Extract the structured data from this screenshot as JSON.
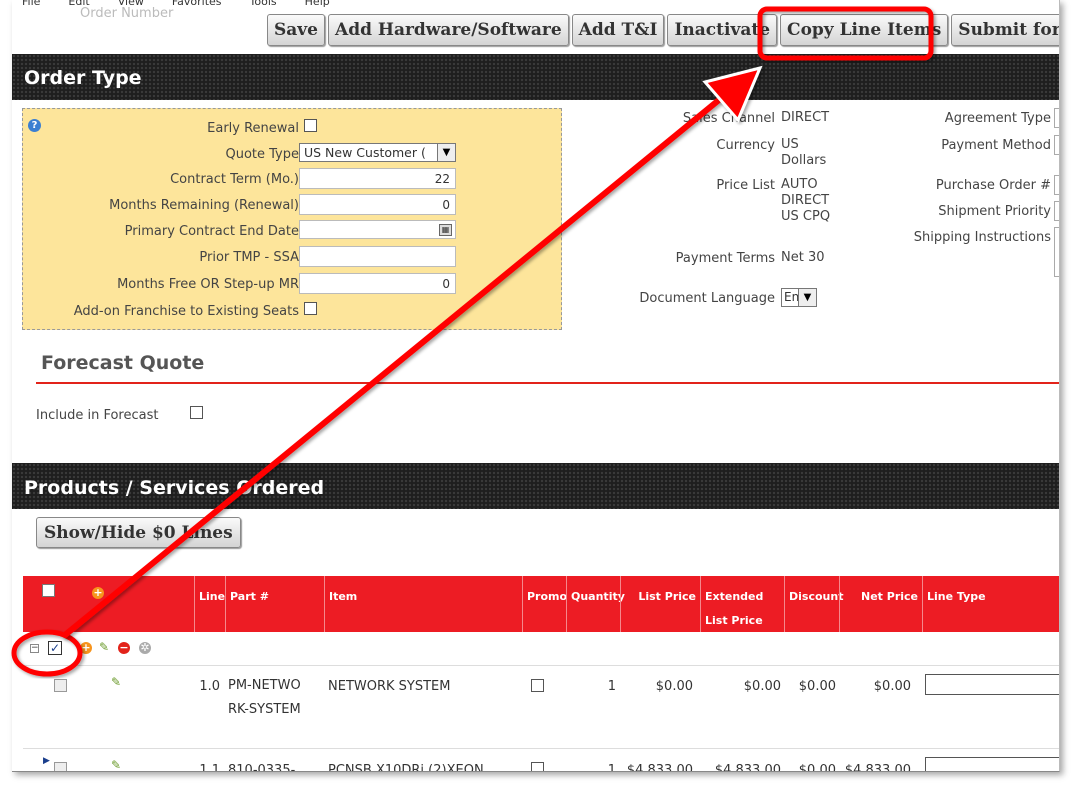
{
  "menubar": [
    "File",
    "Edit",
    "View",
    "Favorites",
    "Tools",
    "Help"
  ],
  "ghost_text": "Order Number",
  "toolbar": {
    "save": "Save",
    "add_hw_sw": "Add Hardware/Software",
    "add_ti": "Add T&I",
    "inactivate": "Inactivate",
    "copy_line_items": "Copy Line Items",
    "submit": "Submit for Ap"
  },
  "order_type": {
    "title": "Order Type",
    "fields": {
      "early_renewal": "Early Renewal",
      "quote_type": "Quote Type",
      "quote_type_value": "US New Customer (",
      "contract_term": "Contract Term (Mo.)",
      "contract_term_value": "22",
      "months_remaining": "Months Remaining (Renewal)",
      "months_remaining_value": "0",
      "primary_end_date": "Primary Contract End Date",
      "prior_tmp": "Prior TMP - SSA",
      "months_free": "Months Free OR Step-up MR",
      "months_free_value": "0",
      "addon_franchise": "Add-on Franchise to Existing Seats"
    },
    "mid": {
      "sales_channel_label": "Sales Channel",
      "sales_channel_value": "DIRECT",
      "currency_label": "Currency",
      "currency_value": "US Dollars",
      "price_list_label": "Price List",
      "price_list_value": "AUTO DIRECT US CPQ",
      "payment_terms_label": "Payment Terms",
      "payment_terms_value": "Net 30",
      "doc_language_label": "Document Language",
      "doc_language_value": "En"
    },
    "right": {
      "agreement_type": "Agreement Type",
      "payment_method": "Payment Method",
      "purchase_order": "Purchase Order #",
      "shipment_priority": "Shipment Priority",
      "shipping_instructions": "Shipping Instructions"
    }
  },
  "forecast": {
    "title": "Forecast Quote",
    "include_label": "Include in Forecast"
  },
  "products": {
    "title": "Products / Services Ordered",
    "show_hide": "Show/Hide $0 Lines",
    "columns": {
      "line": "Line",
      "part": "Part #",
      "item": "Item",
      "promo": "Promo",
      "quantity": "Quantity",
      "list_price": "List Price",
      "extended_list_price": "Extended List Price",
      "discount": "Discount",
      "net_price": "Net Price",
      "line_type": "Line Type"
    },
    "rows": [
      {
        "line": "1.0",
        "part": "PM-NETWORK-SYSTEM",
        "item": "NETWORK SYSTEM",
        "quantity": "1",
        "list_price": "$0.00",
        "extended_list_price": "$0.00",
        "discount": "$0.00",
        "net_price": "$0.00"
      },
      {
        "line": "1.1",
        "part": "810-0335-",
        "item": "PCNSB X10DRi (2)XEON",
        "quantity": "1",
        "list_price": "$4,833.00",
        "extended_list_price": "$4,833.00",
        "discount": "$0.00",
        "net_price": "$4,833.00"
      }
    ]
  },
  "colors": {
    "accent_red": "#ed1c24",
    "annotation_red": "#ff0000",
    "section_dark": "#1e1e1e",
    "field_panel": "#fde59b"
  }
}
